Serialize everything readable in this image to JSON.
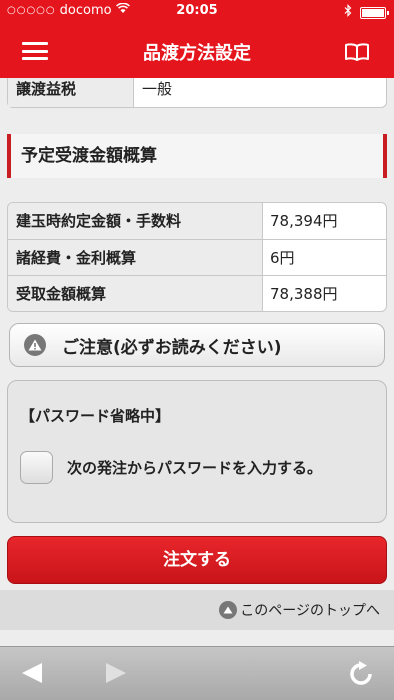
{
  "status_bar": {
    "signal": "○○○○○",
    "carrier": "docomo",
    "time": "20:05",
    "wifi_icon": "wifi-icon",
    "bluetooth_icon": "bluetooth-icon",
    "battery_level": 1.0
  },
  "nav": {
    "title": "品渡方法設定",
    "menu_icon": "hamburger-menu-icon",
    "help_icon": "book-icon"
  },
  "tax_row": {
    "label": "譲渡益税",
    "value": "一般"
  },
  "section": {
    "title": "予定受渡金額概算"
  },
  "summary": {
    "rows": [
      {
        "label": "建玉時約定金額・手数料",
        "value": "78,394円"
      },
      {
        "label": "諸経費・金利概算",
        "value": "6円"
      },
      {
        "label": "受取金額概算",
        "value": "78,388円"
      }
    ]
  },
  "notice": {
    "label": "ご注意(必ずお読みください)",
    "icon": "warning-icon"
  },
  "password": {
    "heading": "【パスワード省略中】",
    "checkbox_label": "次の発注からパスワードを入力する。",
    "checked": false
  },
  "order_button": {
    "label": "注文する"
  },
  "page_top": {
    "label": "このページのトップへ",
    "icon": "arrow-up-circle-icon"
  },
  "toolbar": {
    "back_icon": "back-arrow-icon",
    "forward_icon": "forward-arrow-icon",
    "reload_icon": "reload-icon"
  },
  "colors": {
    "brand_red": "#e5151d",
    "section_accent": "#c81d22",
    "background": "#ededed"
  }
}
